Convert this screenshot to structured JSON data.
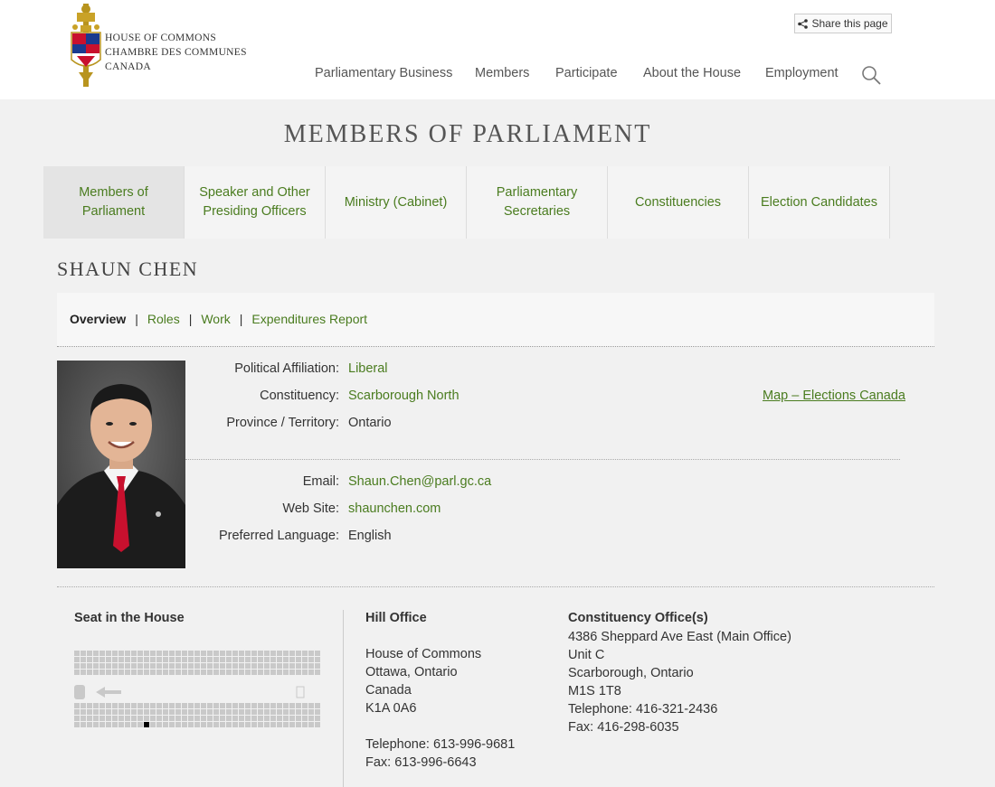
{
  "header": {
    "logo_lines": [
      "HOUSE OF COMMONS",
      "CHAMBRE DES COMMUNES",
      "CANADA"
    ],
    "share_label": "Share this page",
    "nav": [
      "Parliamentary Business",
      "Members",
      "Participate",
      "About the House",
      "Employment"
    ],
    "search_icon": "search-icon"
  },
  "page_title": "MEMBERS OF PARLIAMENT",
  "tabs": [
    {
      "label": "Members of Parliament",
      "active": true
    },
    {
      "label": "Speaker and Other Presiding Officers",
      "active": false
    },
    {
      "label": "Ministry (Cabinet)",
      "active": false
    },
    {
      "label": "Parliamentary Secretaries",
      "active": false
    },
    {
      "label": "Constituencies",
      "active": false
    },
    {
      "label": "Election Candidates",
      "active": false
    }
  ],
  "mp_name": "SHAUN CHEN",
  "profile_tabs": [
    "Overview",
    "Roles",
    "Work",
    "Expenditures Report"
  ],
  "details": {
    "affiliation_label": "Political Affiliation:",
    "affiliation": "Liberal",
    "constituency_label": "Constituency:",
    "constituency": "Scarborough North",
    "province_label": "Province / Territory:",
    "province": "Ontario",
    "map_link": "Map – Elections Canada",
    "email_label": "Email:",
    "email": "Shaun.Chen@parl.gc.ca",
    "website_label": "Web Site:",
    "website": "shaunchen.com",
    "language_label": "Preferred Language:",
    "language": "English"
  },
  "seat": {
    "title": "Seat in the House"
  },
  "hill_office": {
    "title": "Hill Office",
    "lines": [
      "House of Commons",
      "Ottawa, Ontario",
      "Canada",
      "K1A 0A6"
    ],
    "telephone": "Telephone: 613-996-9681",
    "fax": "Fax: 613-996-6643"
  },
  "constituency_office": {
    "title": "Constituency Office(s)",
    "lines": [
      "4386 Sheppard Ave East (Main Office)",
      "Unit C",
      "Scarborough, Ontario",
      "M1S 1T8",
      "Telephone: 416-321-2436",
      "Fax: 416-298-6035"
    ]
  },
  "colors": {
    "link": "#4a7c1f",
    "background": "#f1f1f1"
  }
}
